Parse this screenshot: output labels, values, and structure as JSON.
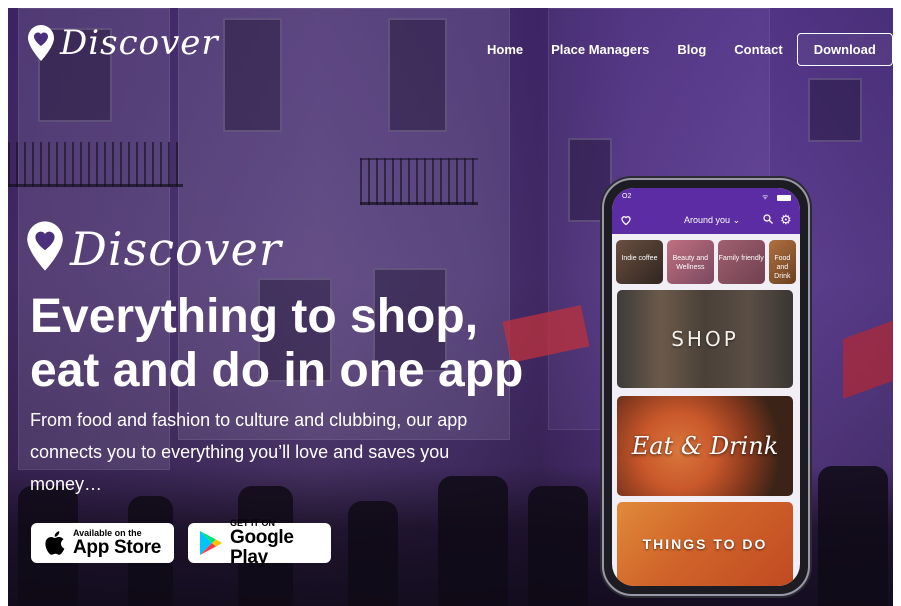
{
  "brand": {
    "name": "Discover"
  },
  "nav": {
    "links": [
      "Home",
      "Place Managers",
      "Blog",
      "Contact"
    ],
    "cta": "Download"
  },
  "hero": {
    "headline_line1": "Everything to shop,",
    "headline_line2": "eat and do in one app",
    "subtext": "From food and fashion to culture and clubbing, our app connects you to everything you’ll love and saves you money…"
  },
  "stores": {
    "apple": {
      "small": "Available on the",
      "big": "App Store"
    },
    "google": {
      "small": "GET IT ON",
      "big": "Google Play"
    }
  },
  "phone": {
    "status_left": "O2",
    "dropdown_label": "Around you",
    "categories": [
      "Indie coffee",
      "Beauty and Wellness",
      "Family friendly",
      "Food and Drink"
    ],
    "tiles": [
      "SHOP",
      "Eat & Drink",
      "THINGS TO DO"
    ]
  },
  "colors": {
    "overlay_purple": "#5b2ca3",
    "text_white": "#ffffff"
  },
  "icons": {
    "logo": "heart-pin-icon",
    "apple": "apple-icon",
    "google_play": "google-play-icon",
    "heart": "heart-icon",
    "search": "search-icon",
    "settings": "gear-icon",
    "chevron": "chevron-down-icon"
  }
}
